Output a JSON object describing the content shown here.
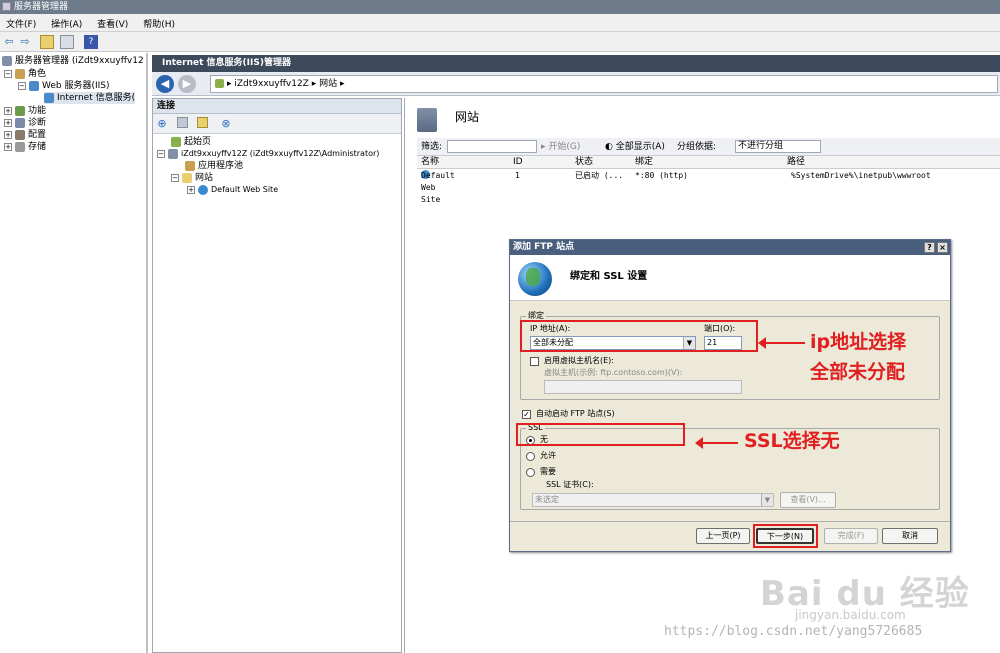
{
  "window": {
    "title": "服务器管理器"
  },
  "menu": [
    "文件(F)",
    "操作(A)",
    "查看(V)",
    "帮助(H)"
  ],
  "left_tree": {
    "root": "服务器管理器 (iZdt9xxuyffv12",
    "roles": "角色",
    "web_server": "Web 服务器(IIS)",
    "iis_manager": "Internet 信息服务(",
    "features": "功能",
    "diagnostics": "诊断",
    "configuration": "配置",
    "storage": "存储"
  },
  "iis": {
    "header": "Internet 信息服务(IIS)管理器",
    "address": "▸ iZdt9xxuyffv12Z ▸ 网站 ▸",
    "connections_title": "连接",
    "conn_tree": {
      "start_page": "起始页",
      "server": "iZdt9xxuyffv12Z (iZdt9xxuyffv12Z\\Administrator)",
      "app_pools": "应用程序池",
      "sites": "网站",
      "default_site": "Default Web Site"
    },
    "sites_title": "网站",
    "filter": {
      "label": "筛选:",
      "start": "开始(G)",
      "show_all": "全部显示(A)",
      "group_by_label": "分组依据:",
      "group_by_value": "不进行分组"
    },
    "columns": [
      "名称",
      "ID",
      "状态",
      "绑定",
      "路径"
    ],
    "rows": [
      {
        "name": "Default Web Site",
        "id": "1",
        "status": "已启动 (...",
        "binding": "*:80 (http)",
        "path": "%SystemDrive%\\inetpub\\wwwroot"
      }
    ]
  },
  "dialog": {
    "title": "添加 FTP 站点",
    "help": "?",
    "close": "×",
    "heading": "绑定和 SSL 设置",
    "binding_group": "绑定",
    "ip_label": "IP 地址(A):",
    "ip_value": "全部未分配",
    "port_label": "端口(O):",
    "port_value": "21",
    "virtual_host_checkbox": "启用虚拟主机名(E):",
    "virtual_host_label": "虚拟主机(示例: ftp.contoso.com)(V):",
    "virtual_host_value": "",
    "auto_start": "自动启动 FTP 站点(S)",
    "ssl_group": "SSL",
    "ssl_none": "无",
    "ssl_allow": "允许",
    "ssl_require": "需要",
    "ssl_cert_label": "SSL 证书(C):",
    "ssl_cert_value": "未选定",
    "view_button": "查看(V)...",
    "buttons": {
      "prev": "上一页(P)",
      "next": "下一步(N)",
      "finish": "完成(F)",
      "cancel": "取消"
    }
  },
  "annotations": {
    "ip_note_line1": "ip地址选择",
    "ip_note_line2": "全部未分配",
    "ssl_note": "SSL选择无"
  },
  "watermarks": {
    "baidu": "Bai du 经验",
    "baidu_url": "jingyan.baidu.com",
    "csdn": "https://blog.csdn.net/yang5726685"
  },
  "colors": {
    "accent_red": "#e02020",
    "title_bar": "#4a5e7e",
    "iis_header": "#3c4a5c"
  }
}
